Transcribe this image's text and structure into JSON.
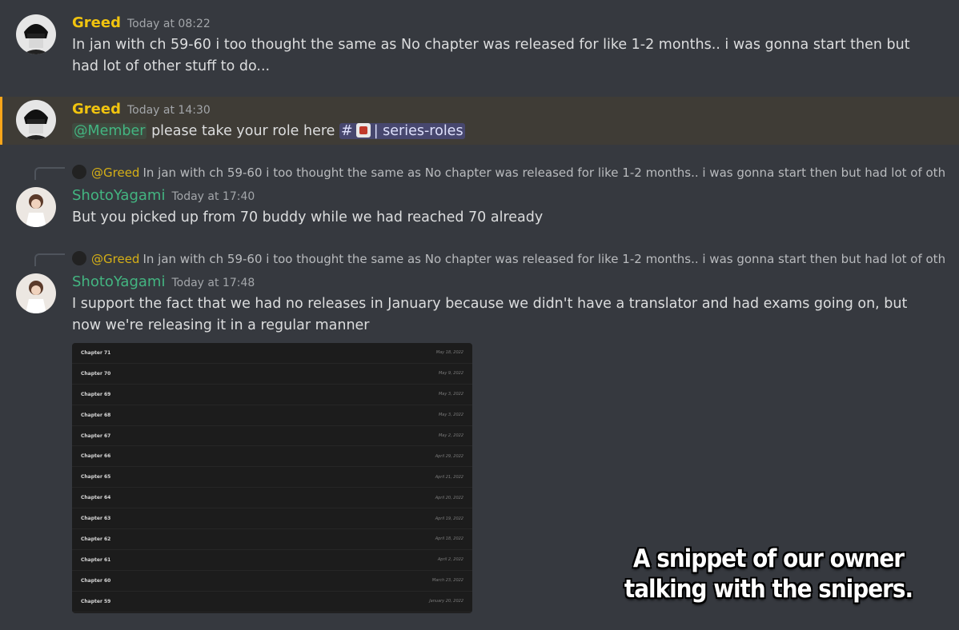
{
  "messages": [
    {
      "author": "Greed",
      "timestamp": "Today at 08:22",
      "text": "In jan with ch 59-60 i too thought the same as No chapter was released for like 1-2 months.. i was gonna start then but had lot of other stuff to do..."
    },
    {
      "author": "Greed",
      "timestamp": "Today at 14:30",
      "mention": "@Member",
      "text": "please take your role here",
      "channel": "| series-roles"
    },
    {
      "reply_author": "@Greed",
      "reply_text": "In jan with ch 59-60 i too thought the same as No chapter was released for like 1-2 months.. i was gonna start then but had lot of oth...",
      "author": "ShotoYagami",
      "timestamp": "Today at 17:40",
      "text": "But you picked up from 70 buddy while we had reached 70 already"
    },
    {
      "reply_author": "@Greed",
      "reply_text": "In jan with ch 59-60 i too thought the same as No chapter was released for like 1-2 months.. i was gonna start then but had lot of oth...",
      "author": "ShotoYagami",
      "timestamp": "Today at 17:48",
      "text": "I support the fact that we had no releases in January because we didn't have a translator and had exams going on, but now we're releasing it in a regular manner"
    }
  ],
  "attachment": {
    "chapters": [
      {
        "name": "Chapter 71",
        "date": "May 18, 2022"
      },
      {
        "name": "Chapter 70",
        "date": "May 9, 2022"
      },
      {
        "name": "Chapter 69",
        "date": "May 3, 2022"
      },
      {
        "name": "Chapter 68",
        "date": "May 3, 2022"
      },
      {
        "name": "Chapter 67",
        "date": "May 2, 2022"
      },
      {
        "name": "Chapter 66",
        "date": "April 29, 2022"
      },
      {
        "name": "Chapter 65",
        "date": "April 21, 2022"
      },
      {
        "name": "Chapter 64",
        "date": "April 20, 2022"
      },
      {
        "name": "Chapter 63",
        "date": "April 19, 2022"
      },
      {
        "name": "Chapter 62",
        "date": "April 18, 2022"
      },
      {
        "name": "Chapter 61",
        "date": "April 2, 2022"
      },
      {
        "name": "Chapter 60",
        "date": "March 23, 2022"
      },
      {
        "name": "Chapter 59",
        "date": "January 20, 2022"
      }
    ]
  },
  "caption": "A snippet of our owner talking with the snipers.",
  "colors": {
    "background": "#36393f",
    "greed_name": "#f1c40f",
    "shoto_name": "#43b581",
    "highlight_border": "#faa61a"
  }
}
